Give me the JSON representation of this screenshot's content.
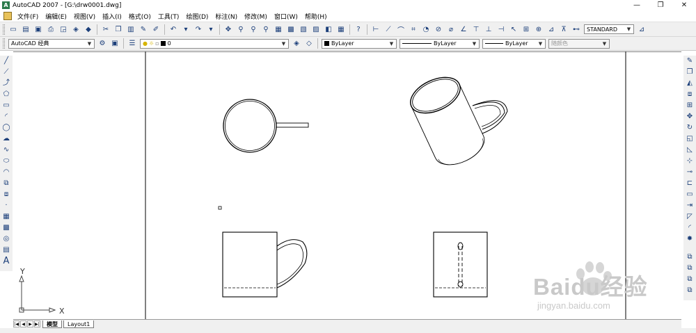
{
  "window": {
    "title": "AutoCAD 2007 - [G:\\drw0001.dwg]",
    "buttons": [
      "—",
      "❐",
      "✕"
    ]
  },
  "menu": [
    "文件(F)",
    "编辑(E)",
    "视图(V)",
    "插入(I)",
    "格式(O)",
    "工具(T)",
    "绘图(D)",
    "标注(N)",
    "修改(M)",
    "窗口(W)",
    "帮助(H)"
  ],
  "toolbar1": {
    "text_style": "STANDARD"
  },
  "toolbar2": {
    "workspace": "AutoCAD 经典",
    "layer": "0",
    "color": "ByLayer",
    "linetype": "ByLayer",
    "lineweight": "ByLayer",
    "plot_style": "随颜色"
  },
  "ucs": {
    "x_label": "X",
    "y_label": "Y"
  },
  "layout_tabs": [
    "模型",
    "Layout1"
  ],
  "watermark": {
    "brand": "Baidu经验",
    "url": "jingyan.baidu.com"
  }
}
